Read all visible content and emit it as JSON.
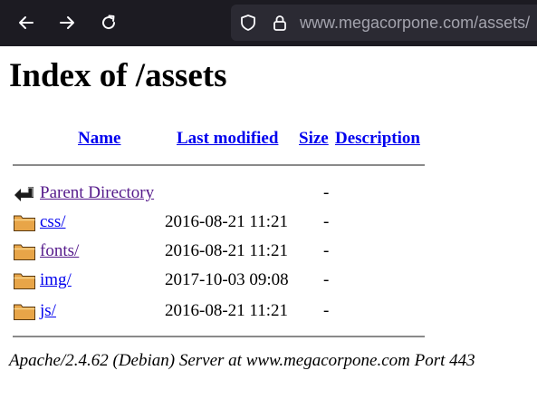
{
  "browser": {
    "url_host": "www.megacorpone.com",
    "url_path": "/assets/",
    "icons": [
      "back-icon",
      "forward-icon",
      "reload-icon",
      "shield-icon",
      "lock-icon"
    ],
    "colors": {
      "toolbar": "#1c1b22",
      "urlbar": "#2b2a33"
    }
  },
  "page": {
    "title": "Index of /assets",
    "headers": {
      "name": "Name",
      "last_modified": "Last modified",
      "size": "Size",
      "description": "Description"
    },
    "rows": [
      {
        "icon": "back-arrow-icon",
        "name": "Parent Directory",
        "modified": "",
        "size": "-",
        "visited": true
      },
      {
        "icon": "folder-icon",
        "name": "css/",
        "modified": "2016-08-21 11:21",
        "size": "-",
        "visited": false
      },
      {
        "icon": "folder-icon",
        "name": "fonts/",
        "modified": "2016-08-21 11:21",
        "size": "-",
        "visited": true
      },
      {
        "icon": "folder-icon",
        "name": "img/",
        "modified": "2017-10-03 09:08",
        "size": "-",
        "visited": false
      },
      {
        "icon": "folder-icon",
        "name": "js/",
        "modified": "2016-08-21 11:21",
        "size": "-",
        "visited": false
      }
    ],
    "footer": "Apache/2.4.62 (Debian) Server at www.megacorpone.com Port 443",
    "colors": {
      "link": "#0000ee",
      "visited": "#551a8b"
    }
  }
}
